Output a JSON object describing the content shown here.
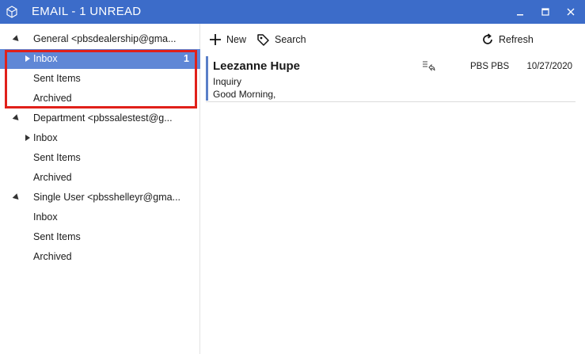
{
  "window": {
    "title": "EMAIL - 1 UNREAD",
    "icon": "cube-icon",
    "accent_color": "#3c6cc9"
  },
  "folders": {
    "accounts": [
      {
        "label": "General  <pbsdealership@gma...",
        "folders": [
          {
            "label": "Inbox",
            "count": "1",
            "selected": true
          },
          {
            "label": "Sent Items"
          },
          {
            "label": "Archived"
          }
        ]
      },
      {
        "label": "Department  <pbssalestest@g...",
        "folders": [
          {
            "label": "Inbox"
          },
          {
            "label": "Sent Items"
          },
          {
            "label": "Archived"
          }
        ]
      },
      {
        "label": "Single User  <pbsshelleyr@gma...",
        "folders": [
          {
            "label": "Inbox"
          },
          {
            "label": "Sent Items"
          },
          {
            "label": "Archived"
          }
        ]
      }
    ],
    "selection_color": "#5f87d6",
    "annotation_color": "#e0201a"
  },
  "toolbar": {
    "new_label": "New",
    "search_label": "Search",
    "refresh_label": "Refresh"
  },
  "messages": [
    {
      "sender": "Leezanne Hupe",
      "subject": "Inquiry",
      "preview": "Good Morning,",
      "to": "PBS PBS",
      "date": "10/27/2020",
      "icon": "reply-icon"
    }
  ]
}
